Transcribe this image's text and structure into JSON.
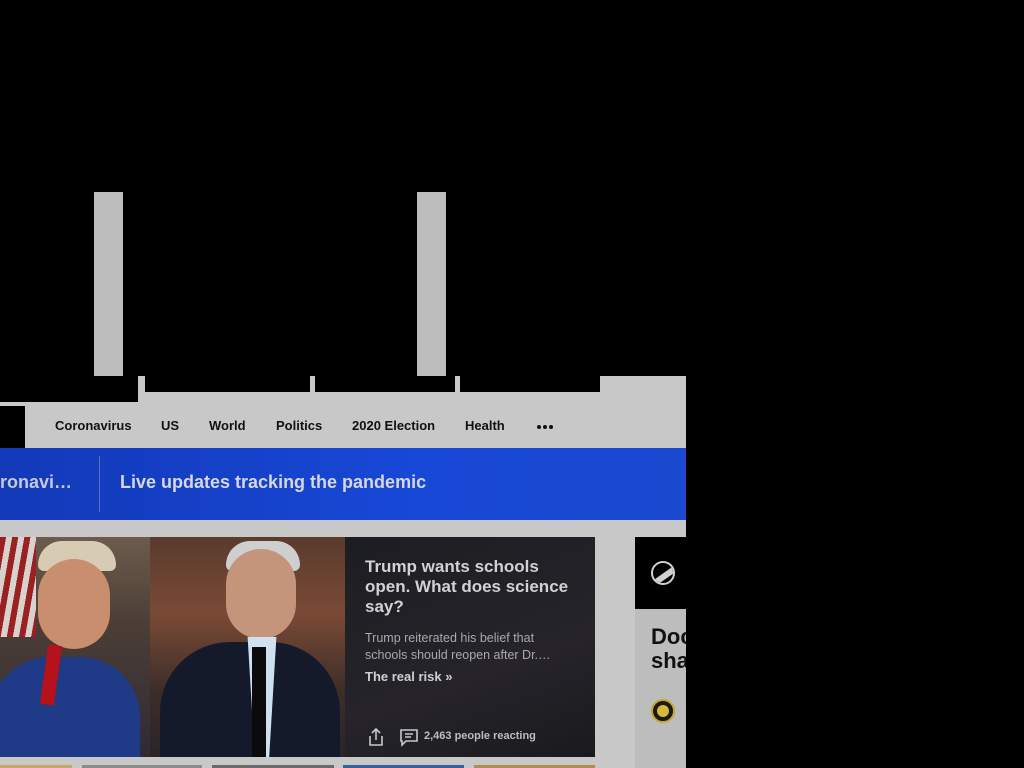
{
  "nav": {
    "items": [
      {
        "label": "Coronavirus"
      },
      {
        "label": "US"
      },
      {
        "label": "World"
      },
      {
        "label": "Politics"
      },
      {
        "label": "2020 Election"
      },
      {
        "label": "Health"
      }
    ],
    "more_icon": "more-horizontal-icon"
  },
  "banner": {
    "left_label": "ronavi…",
    "title": "Live updates tracking the pandemic",
    "colors": {
      "background": "#1748d6"
    }
  },
  "hero": {
    "title": "Trump wants schools open. What does science say?",
    "description": "Trump reiterated his belief that schools should reopen after Dr.…",
    "link": "The real risk »",
    "share_icon": "share-icon",
    "comment_icon": "comment-icon",
    "reaction_count": "2,463 people reacting"
  },
  "right_card": {
    "headline": "Doc\nsha",
    "logo_icon": "publisher-logo-icon",
    "source_icon": "source-badge-icon"
  }
}
